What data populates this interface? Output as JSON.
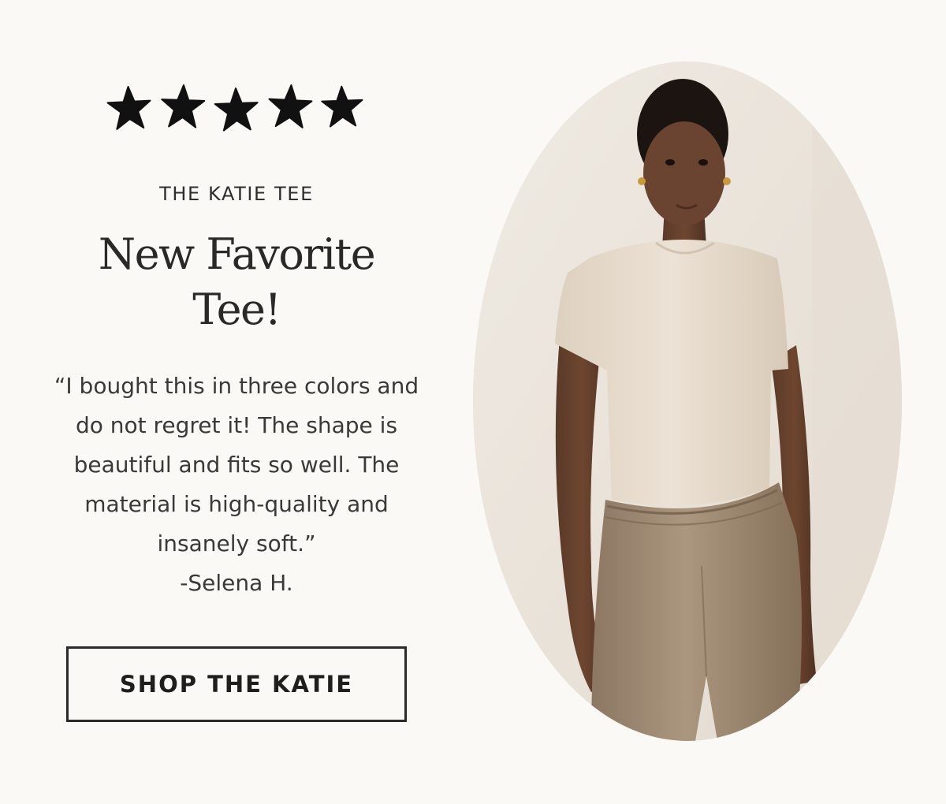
{
  "rating": {
    "stars": 5,
    "max": 5,
    "icon": "star-icon",
    "color": "#111111"
  },
  "product": {
    "eyebrow": "THE KATIE TEE",
    "headline_line1": "New Favorite",
    "headline_line2": "Tee!"
  },
  "review": {
    "quote": "“I bought this in three colors and do not regret it! The shape is beautiful and fits so well. The material is high-quality and insanely soft.”",
    "reviewer": "-Selena H."
  },
  "cta": {
    "label": "SHOP THE KATIE"
  },
  "colors": {
    "background": "#faf9f5",
    "text": "#2b2a28",
    "tee": "#e7dccd",
    "pants": "#a18c77"
  }
}
